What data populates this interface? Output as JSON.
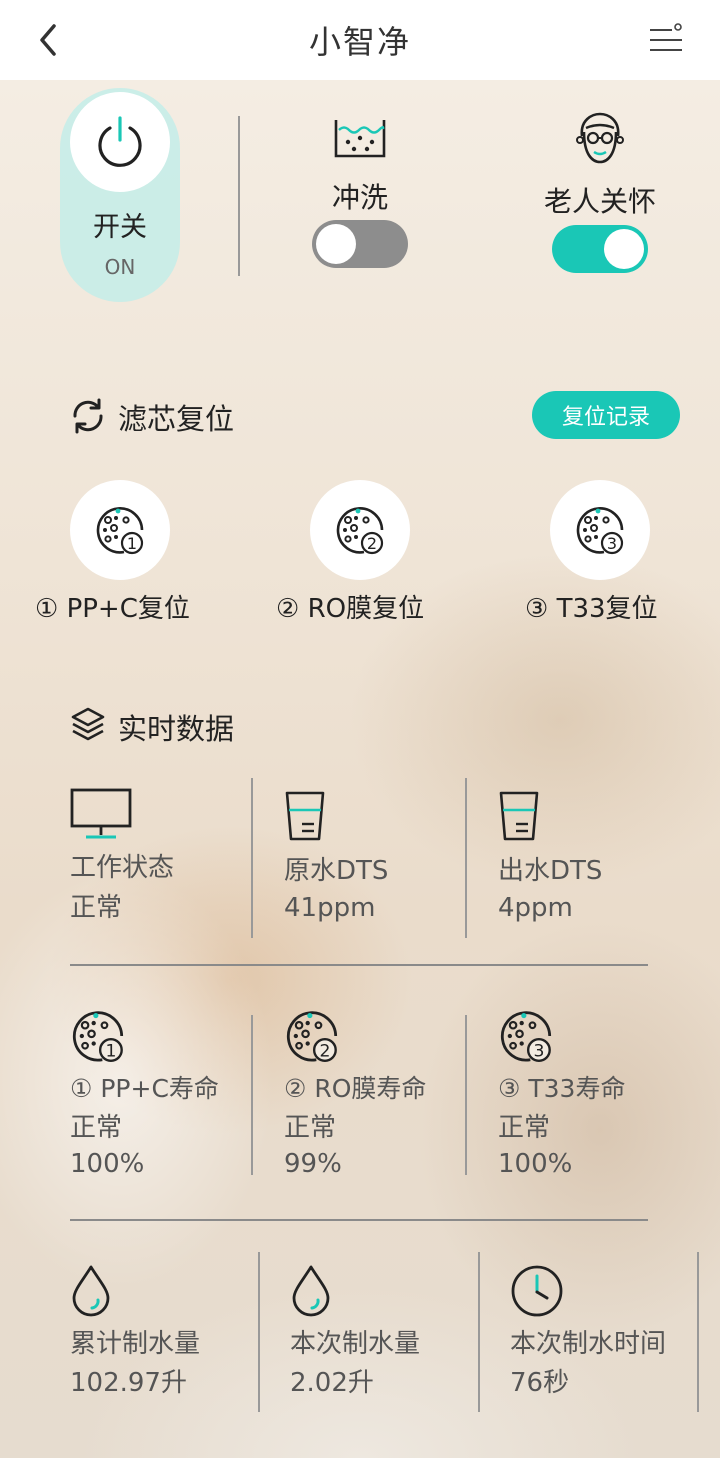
{
  "header": {
    "title": "小智净",
    "back_icon": "chevron-left-icon",
    "menu_icon": "menu-icon"
  },
  "colors": {
    "accent": "#1ac7b6",
    "toggle_off": "#8d8d8d",
    "power_pill": "#bfeeea"
  },
  "controls": {
    "power": {
      "label": "开关",
      "state": "ON",
      "icon": "power-icon"
    },
    "flush": {
      "label": "冲洗",
      "on": false,
      "icon": "water-tank-icon"
    },
    "elder_care": {
      "label": "老人关怀",
      "on": true,
      "icon": "elder-face-icon"
    }
  },
  "filter_reset": {
    "title": "滤芯复位",
    "history_button": "复位记录",
    "items": [
      {
        "label": "① PP+C复位"
      },
      {
        "label": "② RO膜复位"
      },
      {
        "label": "③ T33复位"
      }
    ]
  },
  "realtime": {
    "title": "实时数据",
    "status": [
      {
        "label": "工作状态",
        "value": "正常"
      },
      {
        "label": "原水DTS",
        "value": "41ppm"
      },
      {
        "label": "出水DTS",
        "value": "4ppm"
      }
    ],
    "filters": [
      {
        "label": "① PP+C寿命",
        "status": "正常",
        "percent": "100%"
      },
      {
        "label": "② RO膜寿命",
        "status": "正常",
        "percent": "99%"
      },
      {
        "label": "③ T33寿命",
        "status": "正常",
        "percent": "100%"
      }
    ],
    "water": [
      {
        "label": "累计制水量",
        "value": "102.97升"
      },
      {
        "label": "本次制水量",
        "value": "2.02升"
      },
      {
        "label": "本次制水时间",
        "value": "76秒"
      }
    ]
  }
}
